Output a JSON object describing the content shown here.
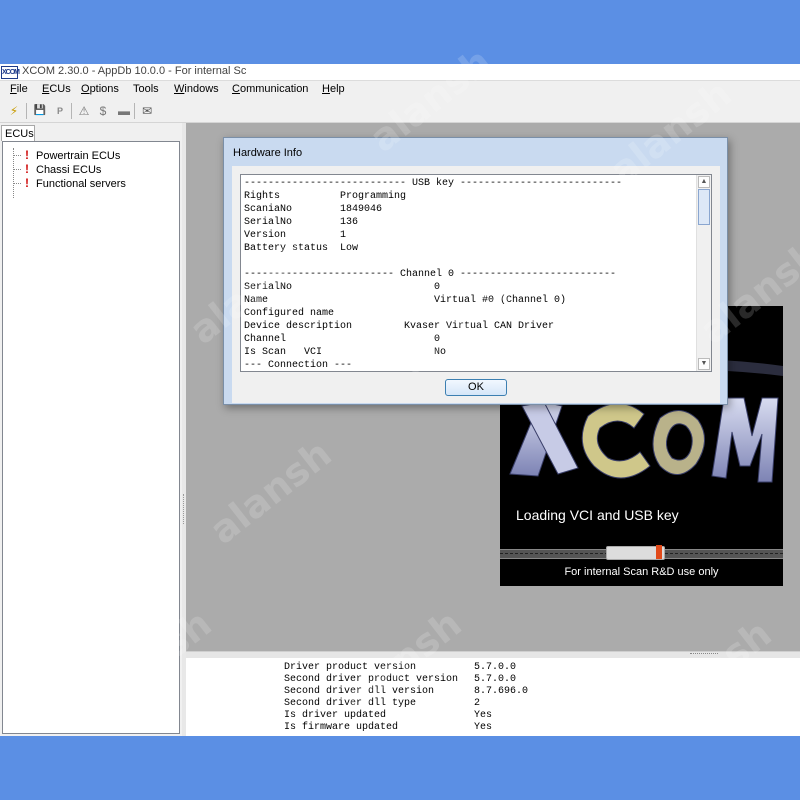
{
  "window": {
    "title": "XCOM 2.30.0 - AppDb 10.0.0 - For internal Sc",
    "app_icon_label": "XCOM"
  },
  "menu": [
    {
      "label": "File",
      "key": "F"
    },
    {
      "label": "ECUs",
      "key": "E"
    },
    {
      "label": "Options",
      "key": "O"
    },
    {
      "label": "Tools",
      "key": ""
    },
    {
      "label": "Windows",
      "key": "W"
    },
    {
      "label": "Communication",
      "key": "C"
    },
    {
      "label": "Help",
      "key": "H"
    }
  ],
  "toolbar": {
    "icons": [
      "lightning-icon",
      "save-icon",
      "parameter-icon",
      "warning-icon",
      "dollar-icon",
      "envelope-icon"
    ],
    "glyphs": [
      "⚡",
      "💾",
      "P",
      "⚠",
      "$",
      "✉"
    ]
  },
  "left_panel": {
    "tab_label": "ECUs",
    "tree": [
      {
        "label": "Powertrain ECUs"
      },
      {
        "label": "Chassi ECUs"
      },
      {
        "label": "Functional servers"
      }
    ]
  },
  "dialog": {
    "title": "Hardware Info",
    "lines": [
      {
        "key": "--------------------------- USB key ---------------------------",
        "value": ""
      },
      {
        "key": "Rights",
        "value": "Programming"
      },
      {
        "key": "ScaniaNo",
        "value": "1849046"
      },
      {
        "key": "SerialNo",
        "value": "136"
      },
      {
        "key": "Version",
        "value": "1"
      },
      {
        "key": "Battery status",
        "value": "Low"
      },
      {
        "key": "",
        "value": ""
      },
      {
        "key": "------------------------- Channel 0 --------------------------",
        "value": ""
      },
      {
        "key": "SerialNo",
        "value": "0"
      },
      {
        "key": "Name",
        "value": "Virtual #0 (Channel 0)"
      },
      {
        "key": "Configured name",
        "value": ""
      },
      {
        "key": "Device description",
        "value": "Kvaser Virtual CAN Driver"
      },
      {
        "key": "Channel",
        "value": "0"
      },
      {
        "key": "Is Scan   VCI",
        "value": "No"
      },
      {
        "key": "--- Connection ---",
        "value": ""
      }
    ],
    "ok_label": "OK"
  },
  "splash": {
    "logo_text": "XCOM",
    "loading_text": "Loading VCI and USB key",
    "footer_text": "For internal Scan    R&D use only"
  },
  "log": [
    {
      "key": "Driver product version",
      "value": "5.7.0.0"
    },
    {
      "key": "Second driver product version",
      "value": "5.7.0.0"
    },
    {
      "key": "Second driver dll version",
      "value": "8.7.696.0"
    },
    {
      "key": "Second driver dll type",
      "value": "2"
    },
    {
      "key": "Is driver updated",
      "value": "Yes"
    },
    {
      "key": "Is firmware updated",
      "value": "Yes"
    }
  ],
  "watermark": "alansh",
  "colors": {
    "desktop": "#5b8fe4",
    "dialog_frame": "#c9daf0",
    "warning_red": "#d01010"
  }
}
